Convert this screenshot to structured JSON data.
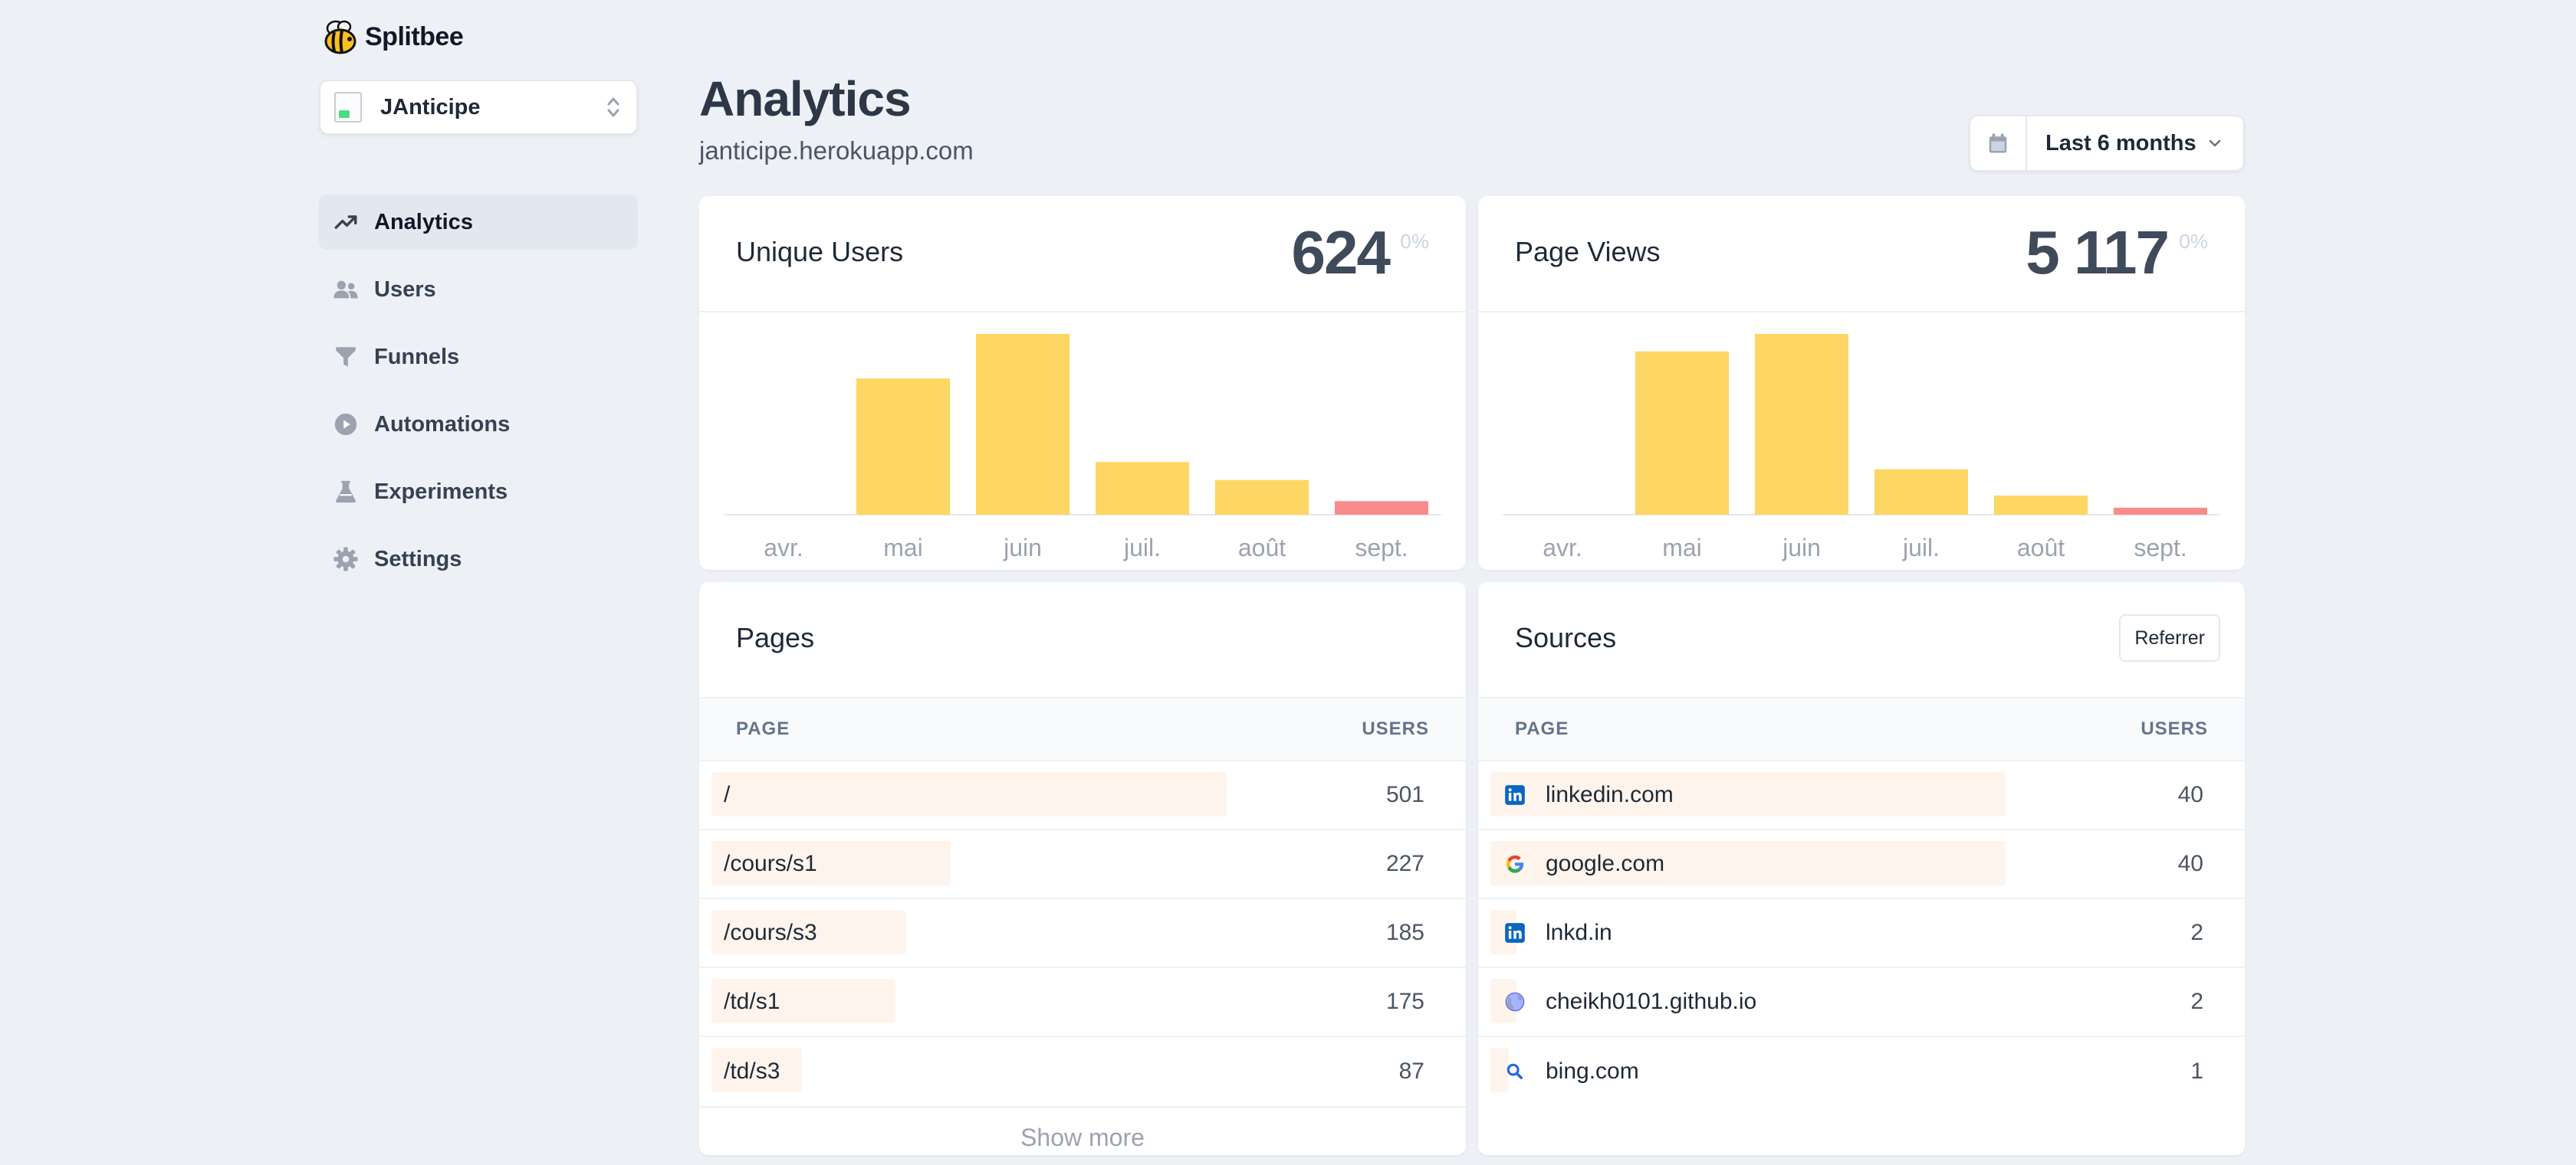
{
  "brand": {
    "name": "Splitbee",
    "icon": "bee-icon"
  },
  "project": {
    "name": "JAnticipe"
  },
  "nav": [
    {
      "label": "Analytics",
      "icon": "trend-icon",
      "active": true
    },
    {
      "label": "Users",
      "icon": "users-icon"
    },
    {
      "label": "Funnels",
      "icon": "funnel-icon"
    },
    {
      "label": "Automations",
      "icon": "play-icon"
    },
    {
      "label": "Experiments",
      "icon": "flask-icon"
    },
    {
      "label": "Settings",
      "icon": "gear-icon"
    }
  ],
  "header": {
    "title": "Analytics",
    "subtitle": "janticipe.herokuapp.com"
  },
  "date_range": {
    "label": "Last 6 months"
  },
  "stats": {
    "users": {
      "title": "Unique Users",
      "value": "624",
      "change": "0%"
    },
    "views": {
      "title": "Page Views",
      "value": "5 117",
      "change": "0%"
    }
  },
  "colors": {
    "bar": "#fdd663",
    "partial_bar": "#f98b8b",
    "accent_bg": "#fff4ec"
  },
  "chart_data": [
    {
      "type": "bar",
      "title": "Unique Users",
      "categories": [
        "avr.",
        "mai",
        "juin",
        "juil.",
        "août",
        "sept."
      ],
      "values": [
        0,
        251,
        333,
        97,
        64,
        25
      ],
      "partial_last": true
    },
    {
      "type": "bar",
      "title": "Page Views",
      "categories": [
        "avr.",
        "mai",
        "juin",
        "juil.",
        "août",
        "sept."
      ],
      "values": [
        0,
        1870,
        2070,
        520,
        220,
        80
      ],
      "partial_last": true
    }
  ],
  "pages": {
    "title": "Pages",
    "col_page": "PAGE",
    "col_users": "USERS",
    "rows": [
      {
        "label": "/",
        "value": "501"
      },
      {
        "label": "/cours/s1",
        "value": "227"
      },
      {
        "label": "/cours/s3",
        "value": "185"
      },
      {
        "label": "/td/s1",
        "value": "175"
      },
      {
        "label": "/td/s3",
        "value": "87"
      }
    ],
    "show_more": "Show more"
  },
  "sources": {
    "title": "Sources",
    "filter_button": "Referrer",
    "col_page": "PAGE",
    "col_users": "USERS",
    "rows": [
      {
        "label": "linkedin.com",
        "value": "40",
        "icon": "linkedin-icon"
      },
      {
        "label": "google.com",
        "value": "40",
        "icon": "google-icon"
      },
      {
        "label": "lnkd.in",
        "value": "2",
        "icon": "linkedin-icon"
      },
      {
        "label": "cheikh0101.github.io",
        "value": "2",
        "icon": "globe-icon"
      },
      {
        "label": "bing.com",
        "value": "1",
        "icon": "search-icon"
      }
    ]
  }
}
